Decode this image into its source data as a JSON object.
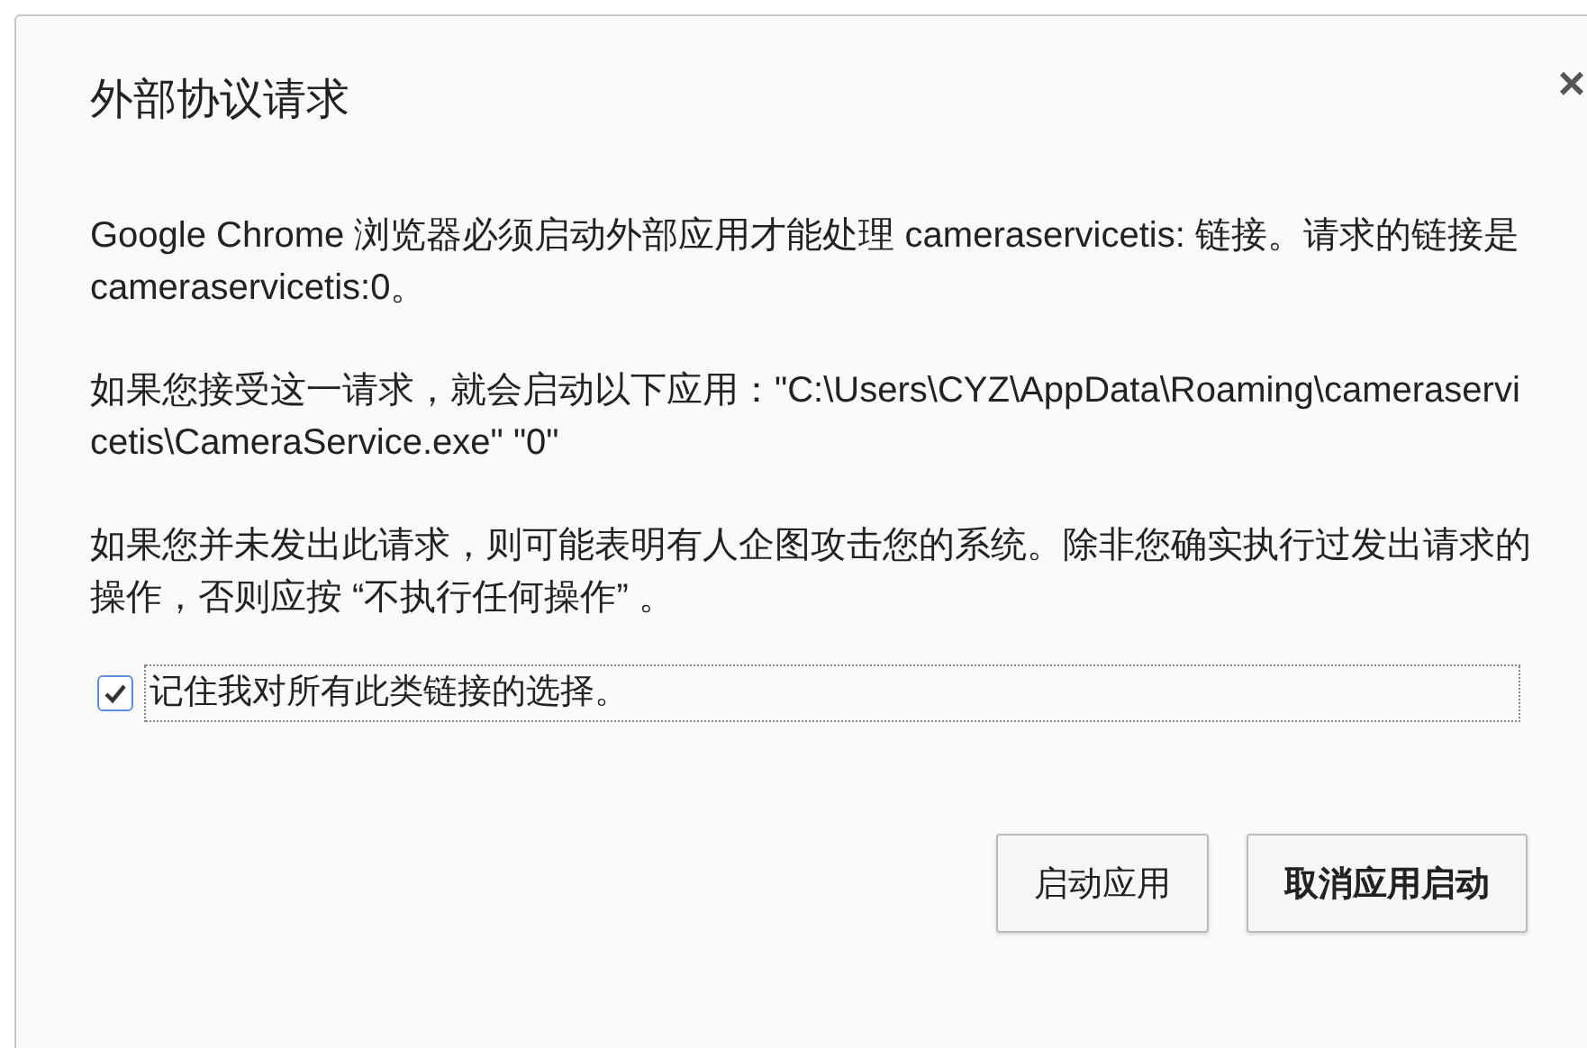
{
  "dialog": {
    "title": "外部协议请求",
    "close": "×",
    "paragraphs": [
      "Google Chrome 浏览器必须启动外部应用才能处理 cameraservicetis: 链接。请求的链接是 cameraservicetis:0。",
      "如果您接受这一请求，就会启动以下应用：\"C:\\Users\\CYZ\\AppData\\Roaming\\cameraservicetis\\CameraService.exe\" \"0\"",
      "如果您并未发出此请求，则可能表明有人企图攻击您的系统。除非您确实执行过发出请求的操作，否则应按 “不执行任何操作” 。"
    ],
    "remember": {
      "label": "记住我对所有此类链接的选择。",
      "checked": true
    },
    "buttons": [
      {
        "label": "启动应用",
        "default": false
      },
      {
        "label": "取消应用启动",
        "default": true
      }
    ]
  }
}
